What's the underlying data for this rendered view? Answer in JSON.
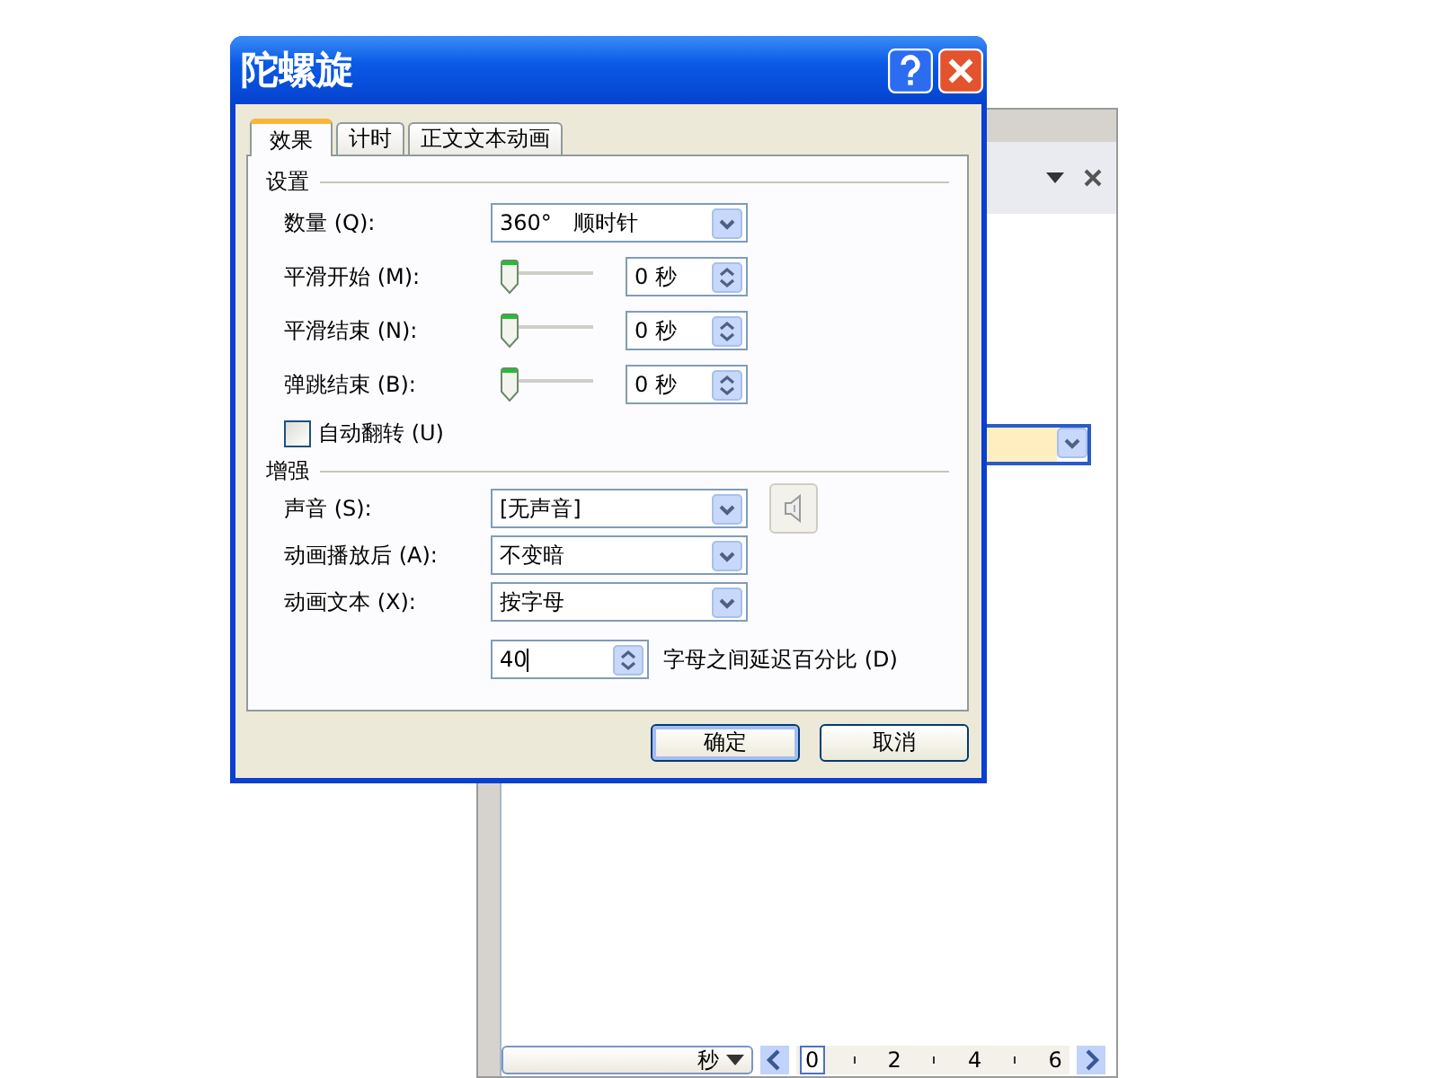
{
  "dialog": {
    "title": "陀螺旋",
    "tabs": [
      {
        "label": "效果",
        "selected": true
      },
      {
        "label": "计时",
        "selected": false
      },
      {
        "label": "正文文本动画",
        "selected": false
      }
    ],
    "settings": {
      "heading": "设置",
      "rows": [
        {
          "kind": "dropdown",
          "label": "数量 (Q):",
          "value": "360°　顺时针"
        },
        {
          "kind": "slider",
          "label": "平滑开始 (M):",
          "level": 0,
          "value": "0 秒"
        },
        {
          "kind": "slider",
          "label": "平滑结束 (N):",
          "level": 0,
          "value": "0 秒"
        },
        {
          "kind": "slider",
          "label": "弹跳结束 (B):",
          "level": 0,
          "value": "0 秒"
        }
      ]
    },
    "auto_reverse": {
      "label": "自动翻转 (U)",
      "checked": false
    },
    "enhance": {
      "heading": "增强",
      "rows": [
        {
          "label": "声音 (S):",
          "value": "[无声音]",
          "preview": true
        },
        {
          "label": "动画播放后 (A):",
          "value": "不变暗",
          "preview": false
        },
        {
          "label": "动画文本 (X):",
          "value": "按字母",
          "preview": false
        }
      ],
      "delay": {
        "value": "40",
        "label": "字母之间延迟百分比 (D)"
      }
    },
    "buttons": [
      {
        "label": "确定",
        "default": true
      },
      {
        "label": "取消",
        "default": false
      }
    ]
  },
  "task_pane": {
    "unit": "秒",
    "ruler_ticks": [
      {
        "label": "0",
        "selected": true
      },
      {
        "label": "2",
        "selected": false
      },
      {
        "label": "4",
        "selected": false
      },
      {
        "label": "6",
        "selected": false
      }
    ]
  }
}
